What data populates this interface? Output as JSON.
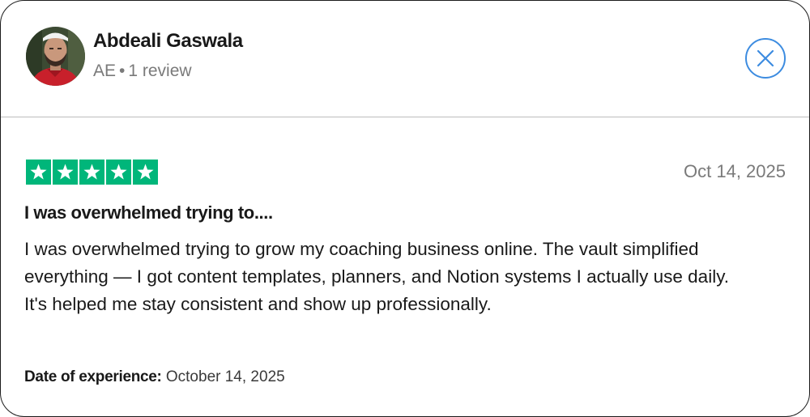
{
  "reviewer": {
    "name": "Abdeali Gaswala",
    "country": "AE",
    "separator": "•",
    "review_count": "1 review"
  },
  "close_button": {
    "icon": "close-icon",
    "color": "#3d8ce0"
  },
  "review": {
    "rating": 5,
    "rating_max": 5,
    "star_color": "#00b67a",
    "date": "Oct 14, 2025",
    "title": "I was overwhelmed trying to....",
    "body": "I was overwhelmed trying to grow my coaching business online. The vault simplified everything — I got content templates, planners, and Notion systems I actually use daily. It's helped me stay consistent and show up professionally.",
    "experience_label": "Date of experience:",
    "experience_date": "October 14, 2025"
  }
}
